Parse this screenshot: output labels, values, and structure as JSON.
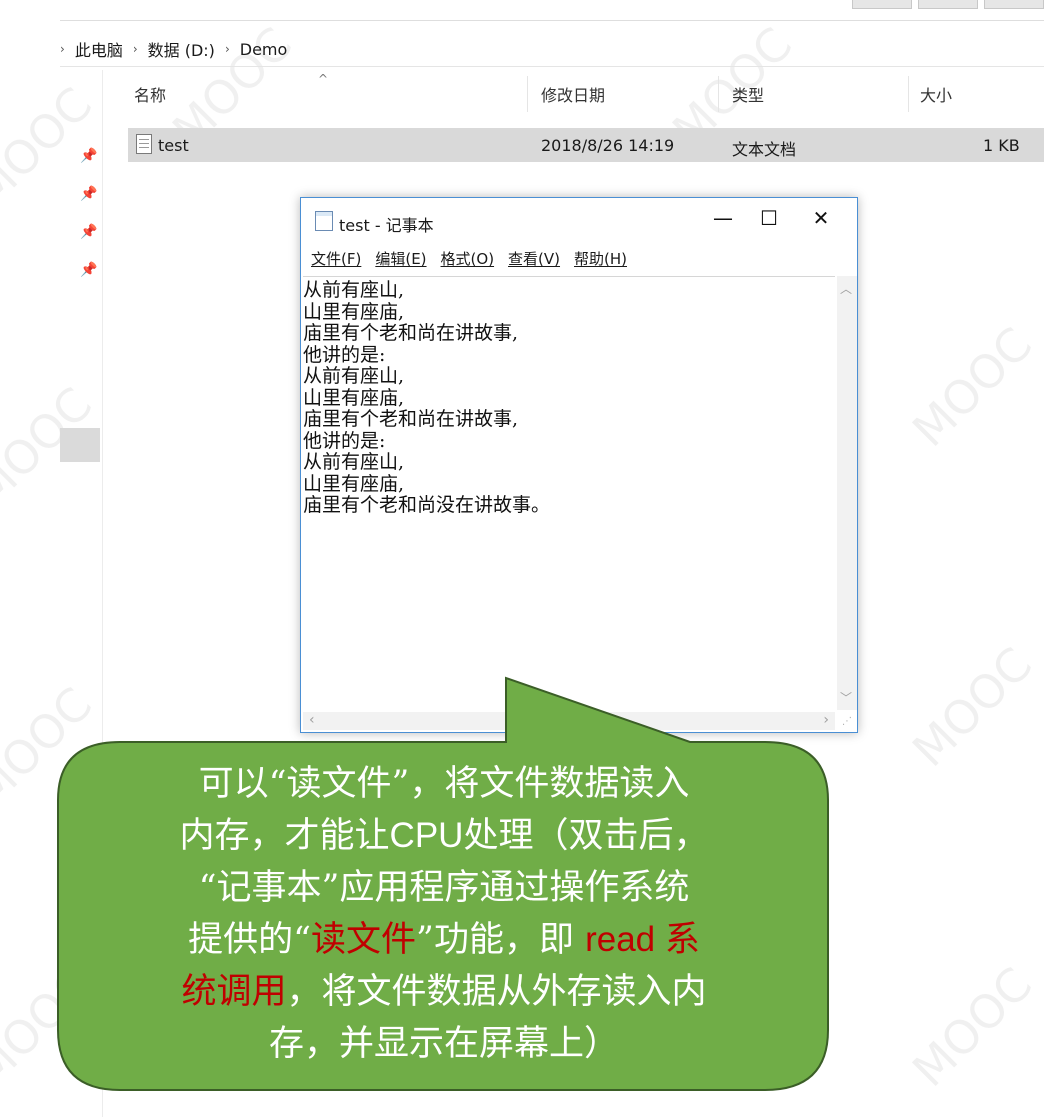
{
  "breadcrumb": [
    "此电脑",
    "数据 (D:)",
    "Demo"
  ],
  "columns": {
    "name": "名称",
    "modified": "修改日期",
    "type": "类型",
    "size": "大小"
  },
  "files": [
    {
      "name": "test",
      "modified": "2018/8/26 14:19",
      "type": "文本文档",
      "size": "1 KB"
    }
  ],
  "notepad": {
    "title": "test - 记事本",
    "controls": {
      "minimize": "—",
      "maximize": "☐",
      "close": "✕"
    },
    "menu": [
      "文件(F)",
      "编辑(E)",
      "格式(O)",
      "查看(V)",
      "帮助(H)"
    ],
    "lines": [
      "从前有座山,",
      "山里有座庙,",
      "庙里有个老和尚在讲故事,",
      "他讲的是:",
      "从前有座山,",
      "山里有座庙,",
      "庙里有个老和尚在讲故事,",
      "他讲的是:",
      "从前有座山,",
      "山里有座庙,",
      "庙里有个老和尚没在讲故事。"
    ]
  },
  "callout": {
    "line1": "可以“读文件”，将文件数据读入",
    "line2a": "内存，才能让",
    "line2b": "CPU",
    "line2c": "处理（双击后，",
    "line3": "“记事本”应用程序通过操作系统",
    "line4a": "提供的“",
    "line4b": "读文件",
    "line4c": "”功能，即 ",
    "line4d": "read 系",
    "line5a": "统调用",
    "line5b": "，将文件数据从外存读入内",
    "line6": "存，并显示在屏幕上）",
    "fill_color": "#70ad47",
    "stroke_color": "#3b5e27",
    "highlight_color": "#c00000"
  }
}
